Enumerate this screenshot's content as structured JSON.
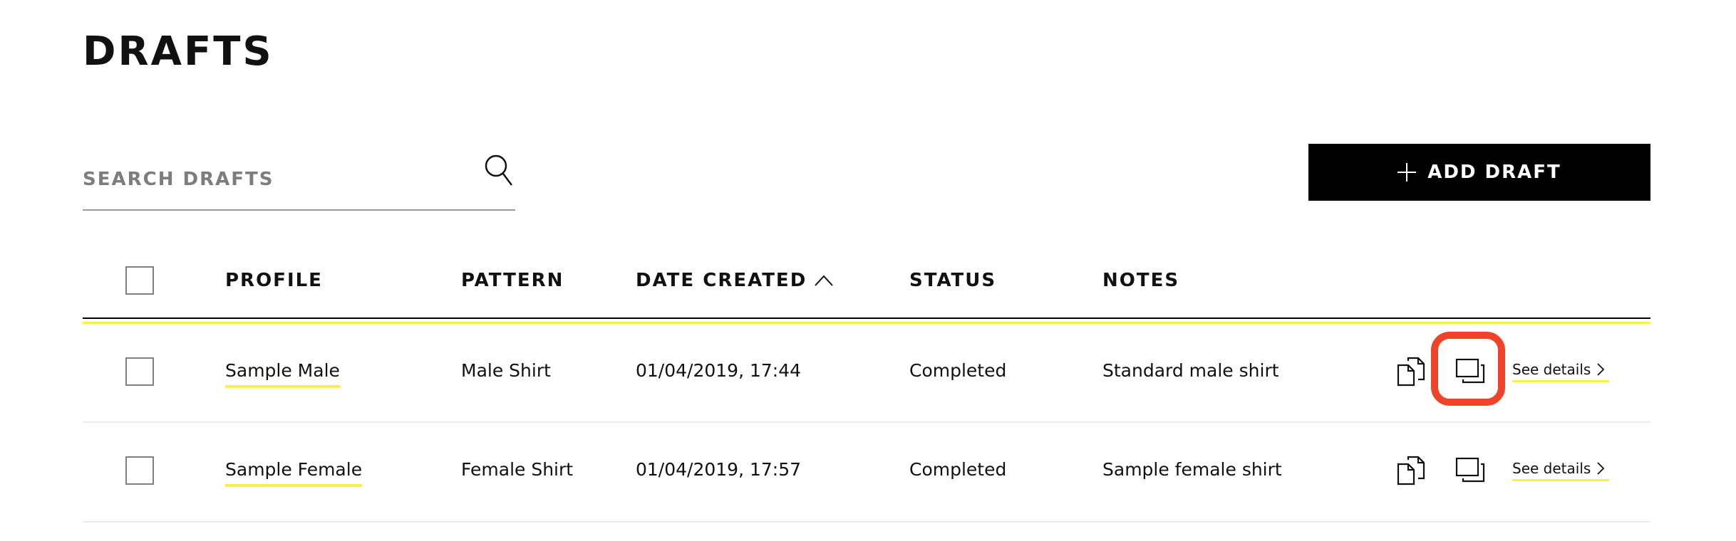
{
  "page": {
    "title": "DRAFTS"
  },
  "search": {
    "placeholder": "SEARCH DRAFTS",
    "value": "",
    "icon": "search-icon"
  },
  "toolbar": {
    "add_label": "ADD DRAFT",
    "add_icon": "plus-icon"
  },
  "colors": {
    "accent_yellow": "#f7f146",
    "highlight_red": "#f0442a",
    "primary_button": "#000000"
  },
  "table": {
    "columns": [
      {
        "label": "PROFILE"
      },
      {
        "label": "PATTERN"
      },
      {
        "label": "DATE CREATED",
        "sort": "ascending"
      },
      {
        "label": "STATUS"
      },
      {
        "label": "NOTES"
      }
    ],
    "rows": [
      {
        "profile": "Sample Male",
        "pattern": "Male Shirt",
        "date_created": "01/04/2019, 17:44",
        "status": "Completed",
        "notes": "Standard male shirt",
        "details_label": "See details",
        "checked": false
      },
      {
        "profile": "Sample Female",
        "pattern": "Female Shirt",
        "date_created": "01/04/2019, 17:57",
        "status": "Completed",
        "notes": "Sample female shirt",
        "details_label": "See details",
        "checked": false
      }
    ]
  }
}
